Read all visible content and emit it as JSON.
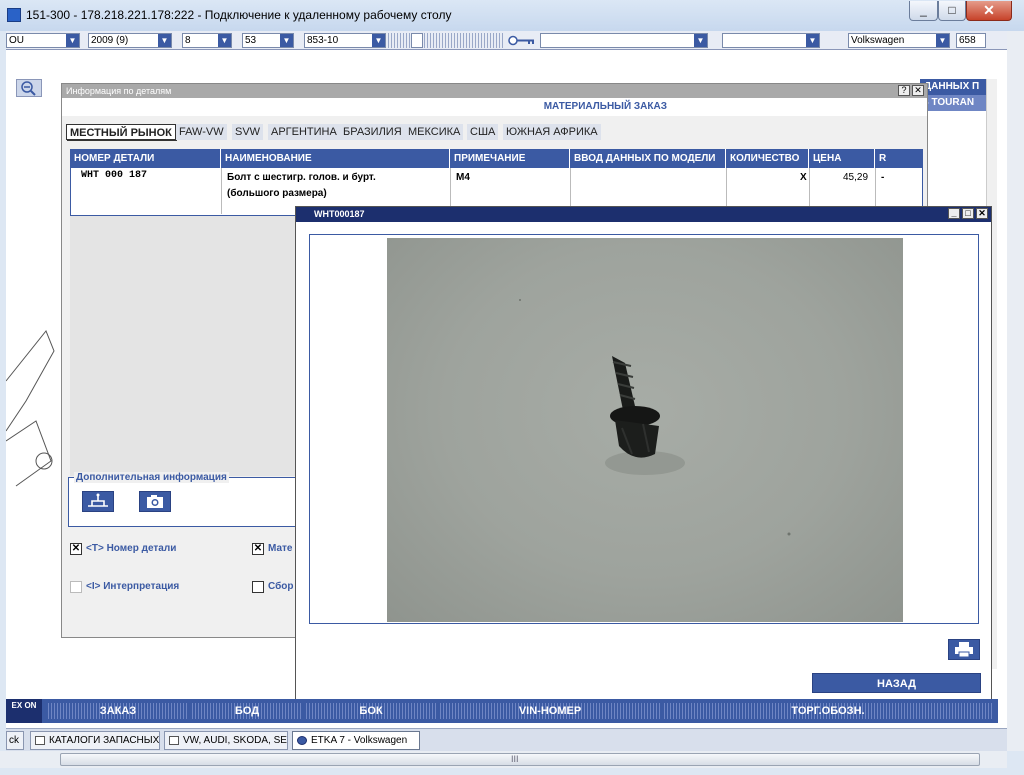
{
  "window": {
    "title": "151-300 - 178.218.221.178:222 - Подключение к удаленному рабочему столу",
    "min_label": "_",
    "max_label": "□",
    "close_label": "✕"
  },
  "topbar": {
    "combo1": "OU",
    "combo2": "2009 (9)",
    "combo3": "8",
    "combo4": "53",
    "combo5": "853-10",
    "combo6": "",
    "combo7": "",
    "brand": "Volkswagen",
    "code": "658"
  },
  "bg_right": {
    "header1": "ДАННЫХ П",
    "header2": "S TOURAN"
  },
  "detail_dialog": {
    "title": "Информация по деталям",
    "help_label": "?",
    "close_label": "✕",
    "order_header": "МАТЕРИАЛЬНЫЙ ЗАКАЗ",
    "tabs": [
      "МЕСТНЫЙ РЫНОК",
      "FAW-VW",
      "SVW",
      "АРГЕНТИНА",
      "БРАЗИЛИЯ",
      "МЕКСИКА",
      "США",
      "ЮЖНАЯ АФРИКА"
    ],
    "columns": [
      "НОМЕР ДЕТАЛИ",
      "НАИМЕНОВАНИЕ",
      "ПРИМЕЧАНИЕ",
      "ВВОД ДАННЫХ ПО МОДЕЛИ",
      "КОЛИЧЕСТВО",
      "ЦЕНА",
      "R"
    ],
    "row": {
      "part_no": "WHT 000 187",
      "name_line1": "Болт с шестигр. голов. и бурт.",
      "name_line2": "(большого размера)",
      "note": "M4",
      "model_data": "",
      "qty": "X",
      "price": "45,29",
      "r": "-"
    },
    "add_info_label": "Дополнительная информация",
    "checkboxes": [
      {
        "label": "<T> Номер детали",
        "checked": true
      },
      {
        "label": "Мате",
        "checked": true
      },
      {
        "label": "<I> Интерпретация",
        "checked": false
      },
      {
        "label": "Сбор",
        "checked": false
      }
    ]
  },
  "image_window": {
    "title": "WHT000187",
    "back_label": "НАЗАД"
  },
  "navbar": {
    "logo": "EX ON",
    "items": [
      "ЗАКАЗ",
      "БОД",
      "БОК",
      "VIN-НОМЕР",
      "ТОРГ.ОБОЗН."
    ]
  },
  "taskbar": {
    "start": "ck",
    "tasks": [
      "КАТАЛОГИ ЗАПАСНЫХ ...",
      "VW, AUDI, SKODA, SEAT",
      "ETKA 7 - Volkswagen"
    ]
  },
  "scroll": {
    "grip": "III"
  }
}
